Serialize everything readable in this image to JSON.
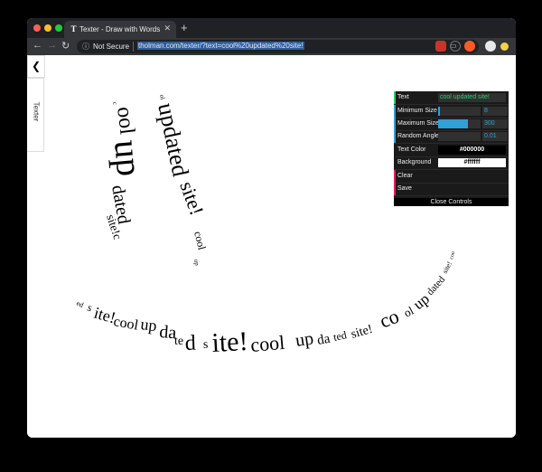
{
  "browser": {
    "tab_title": "Texter - Draw with Words",
    "tab_favicon_letter": "T",
    "security_label": "Not Secure",
    "url": "tholman.com/texter/?text=cool%20updated%20site!"
  },
  "sidebar": {
    "tab_label": "Texter",
    "back_glyph": "❮"
  },
  "controls": {
    "rows": [
      {
        "label": "Text",
        "value": "cool updated site!",
        "type": "text"
      },
      {
        "label": "Minimum Size",
        "value": "8",
        "type": "slider",
        "fraction": 0.02
      },
      {
        "label": "Maximum Size",
        "value": "300",
        "type": "slider",
        "fraction": 0.66
      },
      {
        "label": "Random Angle",
        "value": "0.01",
        "type": "slider",
        "fraction": 0.0
      },
      {
        "label": "Text Color",
        "value": "#000000",
        "type": "color"
      },
      {
        "label": "Background",
        "value": "#ffffff",
        "type": "color"
      },
      {
        "label": "Clear",
        "type": "button"
      },
      {
        "label": "Save",
        "type": "button"
      }
    ],
    "close_label": "Close Controls"
  },
  "colors": {
    "accent": "#2fa1d6",
    "text_green": "#1ed36f"
  },
  "drawing": {
    "strokes": [
      "cool updated site!c",
      "ol updated site!cool up",
      "ed site!cool updated site!cool updated site!cool updated site!coo"
    ]
  }
}
